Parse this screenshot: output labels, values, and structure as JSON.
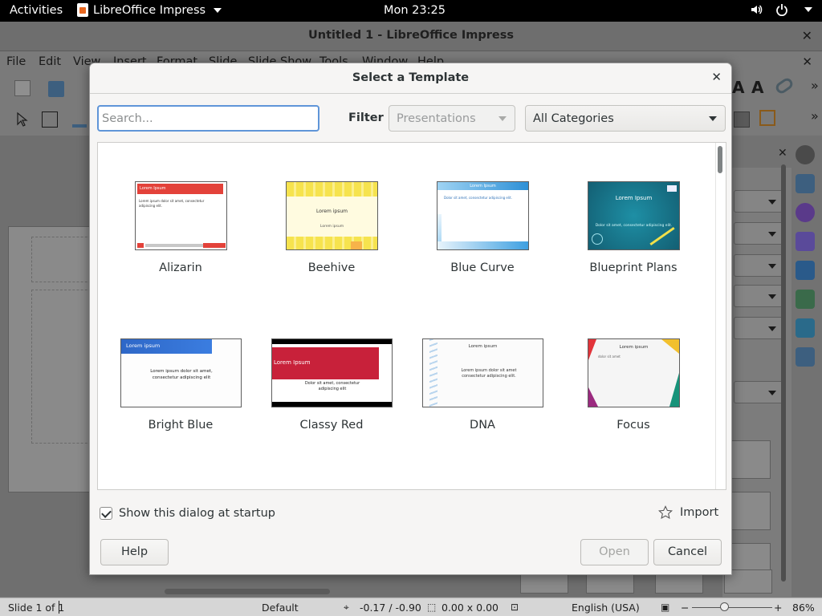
{
  "topbar": {
    "activities": "Activities",
    "app_name": "LibreOffice Impress",
    "clock": "Mon 23:25"
  },
  "window": {
    "title": "Untitled 1 - LibreOffice Impress",
    "menu": [
      "File",
      "Edit",
      "View",
      "Insert",
      "Format",
      "Slide",
      "Slide Show",
      "Tools",
      "Window",
      "Help"
    ]
  },
  "statusbar": {
    "slide": "Slide 1 of 1",
    "master": "Default",
    "position": "-0.17 / -0.90",
    "size": "0.00 x 0.00",
    "language": "English (USA)",
    "zoom": "86%"
  },
  "dialog": {
    "title": "Select a Template",
    "search_placeholder": "Search...",
    "filter_label": "Filter",
    "filter_value": "Presentations",
    "category_value": "All Categories",
    "templates": [
      {
        "name": "Alizarin",
        "thumb_title": "Lorem Ipsum",
        "thumb_text": "Lorem ipsum dolor sit amet, consectetur adipiscing elit."
      },
      {
        "name": "Beehive",
        "thumb_title": "Lorem ipsum",
        "thumb_text": "Lorem ipsum"
      },
      {
        "name": "Blue Curve",
        "thumb_title": "Lorem Ipsum",
        "thumb_text": "Dolor sit amet, consectetur adipiscing elit."
      },
      {
        "name": "Blueprint Plans",
        "thumb_title": "Lorem Ipsum",
        "thumb_text": "Dolor sit amet, consectetur adipiscing elit."
      },
      {
        "name": "Bright Blue",
        "thumb_title": "Lorem ipsum",
        "thumb_text": "Lorem ipsum dolor sit amet, consectetur adipiscing elit"
      },
      {
        "name": "Classy Red",
        "thumb_title": "Lorem Ipsum",
        "thumb_text": "Dolor sit amet, consectetur adipiscing elit"
      },
      {
        "name": "DNA",
        "thumb_title": "Lorem ipsum",
        "thumb_text": "Lorem ipsum dolor sit amet consectetur adipiscing elit."
      },
      {
        "name": "Focus",
        "thumb_title": "Lorem ipsum",
        "thumb_text": "dolor sit amet"
      }
    ],
    "startup_label": "Show this dialog at startup",
    "startup_checked": true,
    "import_label": "Import",
    "help_label": "Help",
    "open_label": "Open",
    "cancel_label": "Cancel"
  }
}
